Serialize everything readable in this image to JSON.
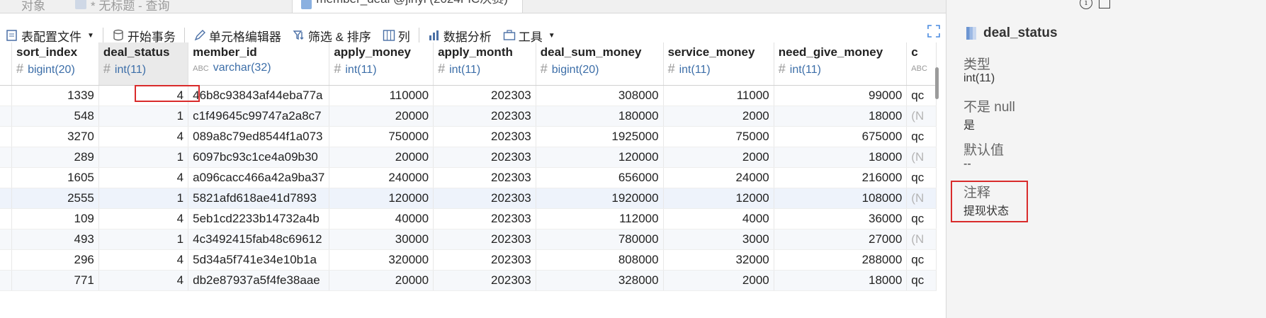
{
  "tabs": [
    {
      "label": "对象"
    },
    {
      "label": "* 无标题 - 查询"
    },
    {
      "label": "member_deal @jinyi (2024FIC决赛) ..."
    }
  ],
  "toolbar": {
    "table_config": "表配置文件",
    "begin_tx": "开始事务",
    "cell_editor": "单元格编辑器",
    "filter_sort": "筛选 & 排序",
    "columns": "列",
    "data_analysis": "数据分析",
    "tools": "工具"
  },
  "grid": {
    "columns": [
      {
        "name": "sort_index",
        "type": "bigint(20)",
        "kind": "num"
      },
      {
        "name": "deal_status",
        "type": "int(11)",
        "kind": "num"
      },
      {
        "name": "member_id",
        "type": "varchar(32)",
        "kind": "text"
      },
      {
        "name": "apply_money",
        "type": "int(11)",
        "kind": "num"
      },
      {
        "name": "apply_month",
        "type": "int(11)",
        "kind": "num"
      },
      {
        "name": "deal_sum_money",
        "type": "bigint(20)",
        "kind": "num"
      },
      {
        "name": "service_money",
        "type": "int(11)",
        "kind": "num"
      },
      {
        "name": "need_give_money",
        "type": "int(11)",
        "kind": "num"
      },
      {
        "name": "c",
        "type": "",
        "kind": "text"
      }
    ],
    "rows": [
      [
        "1339",
        "4",
        "46b8c93843af44eba77a",
        "110000",
        "202303",
        "308000",
        "11000",
        "99000",
        "qc"
      ],
      [
        "548",
        "1",
        "c1f49645c99747a2a8c7",
        "20000",
        "202303",
        "180000",
        "2000",
        "18000",
        "(N"
      ],
      [
        "3270",
        "4",
        "089a8c79ed8544f1a073",
        "750000",
        "202303",
        "1925000",
        "75000",
        "675000",
        "qc"
      ],
      [
        "289",
        "1",
        "6097bc93c1ce4a09b30",
        "20000",
        "202303",
        "120000",
        "2000",
        "18000",
        "(N"
      ],
      [
        "1605",
        "4",
        "a096cacc466a42a9ba37",
        "240000",
        "202303",
        "656000",
        "24000",
        "216000",
        "qc"
      ],
      [
        "2555",
        "1",
        "5821afd618ae41d7893",
        "120000",
        "202303",
        "1920000",
        "12000",
        "108000",
        "(N"
      ],
      [
        "109",
        "4",
        "5eb1cd2233b14732a4b",
        "40000",
        "202303",
        "112000",
        "4000",
        "36000",
        "qc"
      ],
      [
        "493",
        "1",
        "4c3492415fab48c69612",
        "30000",
        "202303",
        "780000",
        "3000",
        "27000",
        "(N"
      ],
      [
        "296",
        "4",
        "5d34a5f741e34e10b1a",
        "320000",
        "202303",
        "808000",
        "32000",
        "288000",
        "qc"
      ],
      [
        "771",
        "4",
        "db2e87937a5f4fe38aae",
        "20000",
        "202303",
        "328000",
        "2000",
        "18000",
        "qc"
      ]
    ]
  },
  "panel": {
    "title": "deal_status",
    "type_label": "类型",
    "type_value": "int(11)",
    "notnull_label": "不是 null",
    "notnull_value": "是",
    "default_label": "默认值",
    "default_value": "--",
    "comment_label": "注释",
    "comment_value": "提现状态"
  },
  "colors": {
    "highlight": "#d92b2b",
    "type_text": "#3c6ea8"
  }
}
